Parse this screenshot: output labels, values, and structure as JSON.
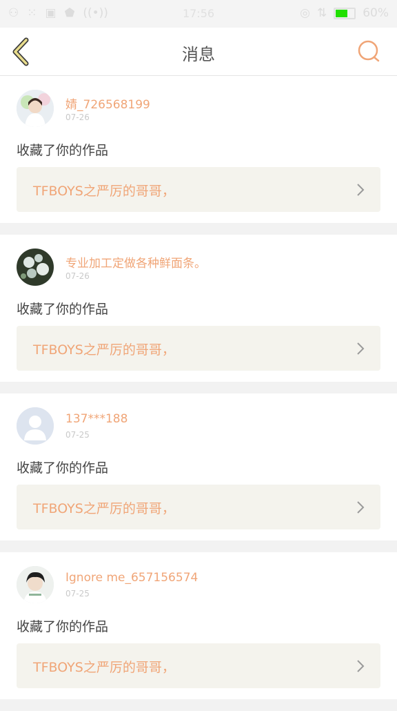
{
  "status_bar": {
    "time": "17:56",
    "battery_percent": "60%",
    "battery_level": 0.6
  },
  "header": {
    "title": "消息"
  },
  "icons": {
    "back": "chevron-left-icon",
    "search": "search-icon",
    "item_arrow": "chevron-right-icon"
  },
  "colors": {
    "accent": "#f0a577",
    "back_icon": "#e8dc8c",
    "work_box_bg": "#f4f3ed",
    "battery": "#22e000"
  },
  "messages": [
    {
      "username": "婧_726568199",
      "date": "07-26",
      "action": "收藏了你的作品",
      "work_title": "TFBOYS之严厉的哥哥，",
      "avatar": "photo-girl"
    },
    {
      "username": "专业加工定做各种鲜面条。",
      "date": "07-26",
      "action": "收藏了你的作品",
      "work_title": "TFBOYS之严厉的哥哥，",
      "avatar": "photo-flowers"
    },
    {
      "username": "137***188",
      "date": "07-25",
      "action": "收藏了你的作品",
      "work_title": "TFBOYS之严厉的哥哥，",
      "avatar": "default-person"
    },
    {
      "username": "Ignore me_657156574",
      "date": "07-25",
      "action": "收藏了你的作品",
      "work_title": "TFBOYS之严厉的哥哥，",
      "avatar": "photo-boy"
    }
  ]
}
